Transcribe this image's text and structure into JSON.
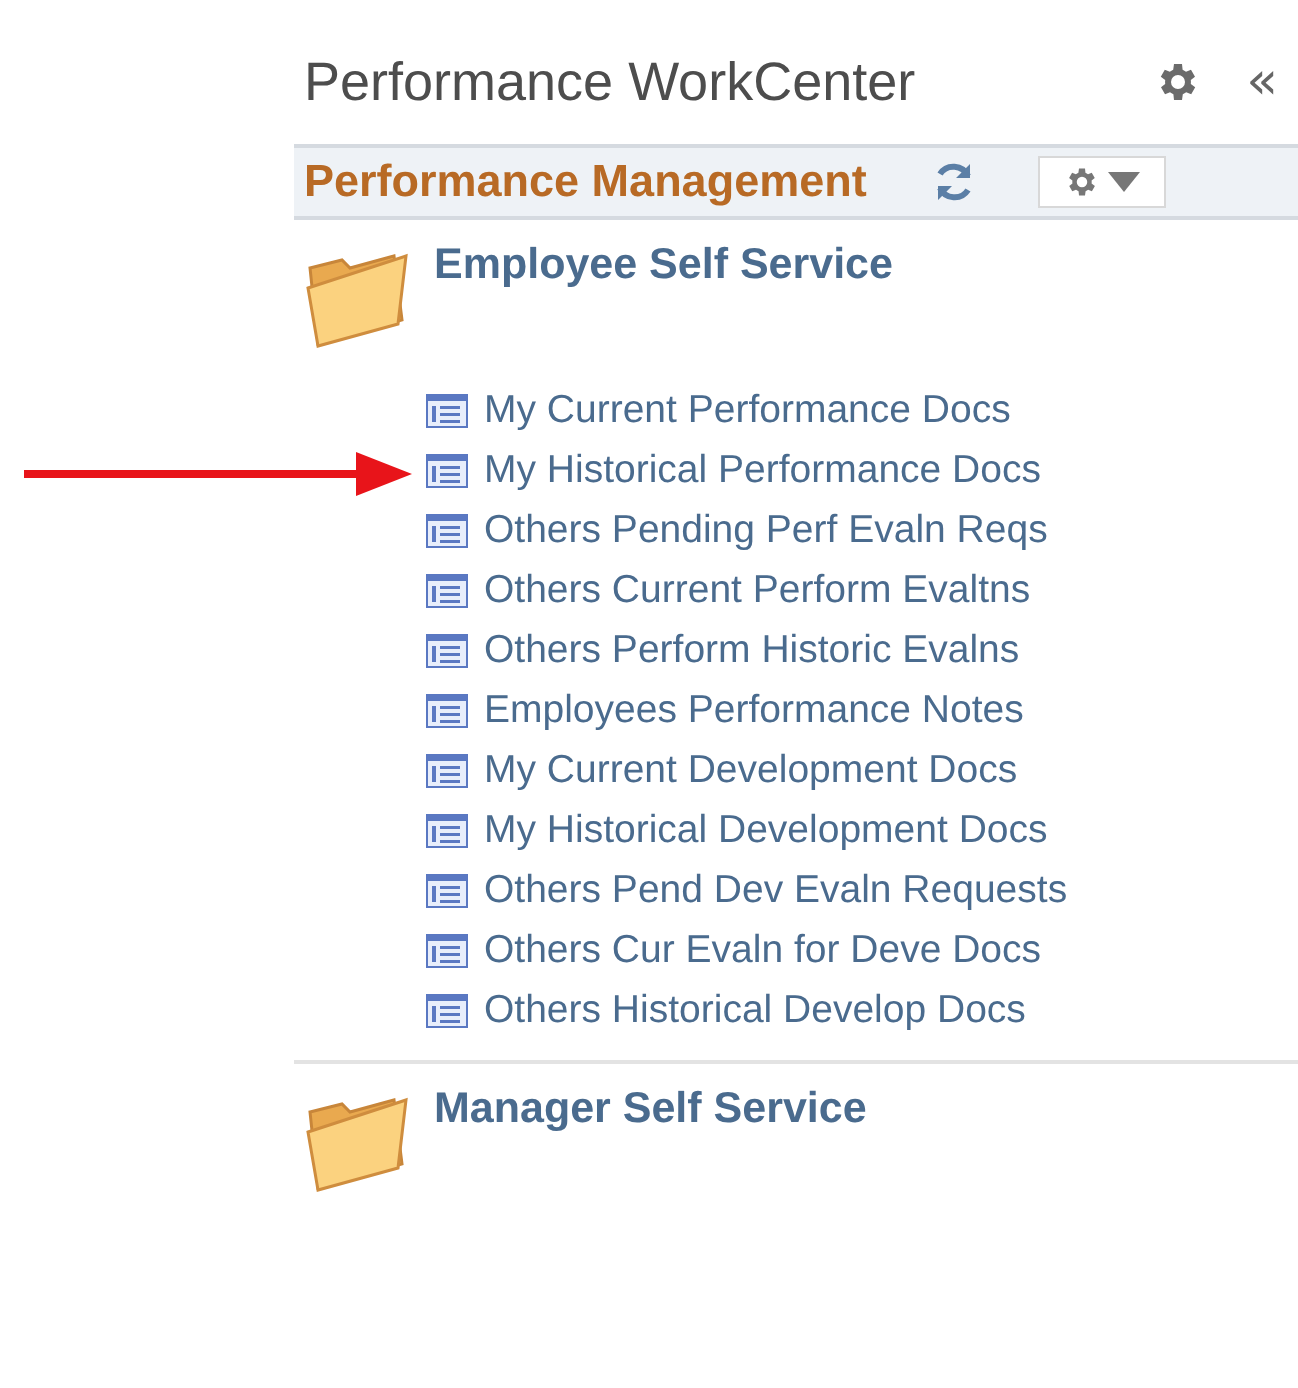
{
  "workcenter": {
    "title": "Performance WorkCenter",
    "collapse_glyph": "«"
  },
  "pagelet": {
    "title": "Performance Management"
  },
  "sections": [
    {
      "title": "Employee Self Service",
      "items": [
        {
          "label": "My Current Performance Docs",
          "pointed": false
        },
        {
          "label": "My Historical Performance Docs",
          "pointed": true
        },
        {
          "label": "Others Pending Perf Evaln Reqs",
          "pointed": false
        },
        {
          "label": "Others Current Perform Evaltns",
          "pointed": false
        },
        {
          "label": "Others Perform Historic Evalns",
          "pointed": false
        },
        {
          "label": "Employees Performance Notes",
          "pointed": false
        },
        {
          "label": "My Current Development Docs",
          "pointed": false
        },
        {
          "label": "My Historical Development Docs",
          "pointed": false
        },
        {
          "label": "Others Pend Dev Evaln Requests",
          "pointed": false
        },
        {
          "label": "Others Cur Evaln for Deve Docs",
          "pointed": false
        },
        {
          "label": "Others Historical Develop Docs",
          "pointed": false
        }
      ]
    },
    {
      "title": "Manager Self Service"
    }
  ]
}
